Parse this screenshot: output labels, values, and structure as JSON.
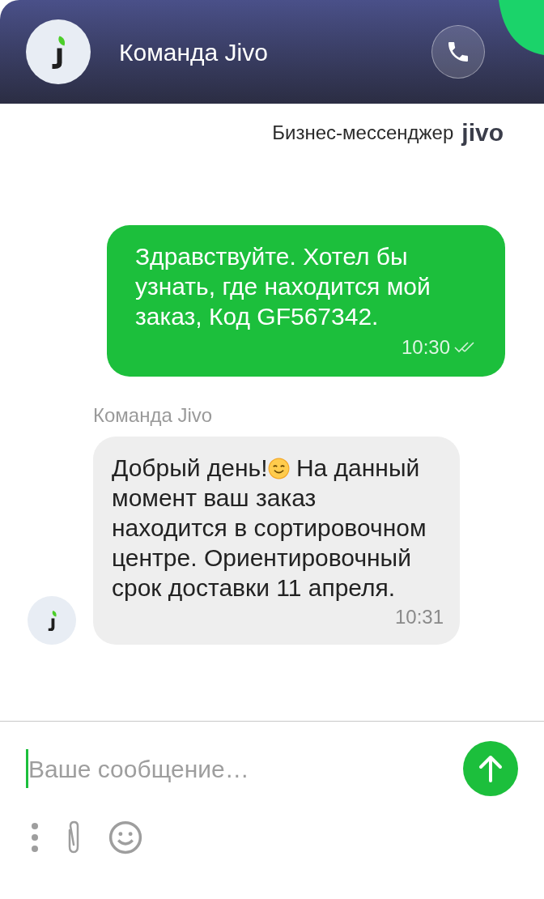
{
  "header": {
    "title": "Команда Jivo"
  },
  "branding": {
    "label": "Бизнес-мессенджер",
    "logo": "jivo"
  },
  "messages": [
    {
      "kind": "outgoing",
      "text": "Здравствуйте. Хотел бы узнать, где находится мой заказ, Код GF567342.",
      "time": "10:30",
      "read": true
    },
    {
      "kind": "incoming",
      "sender": "Команда Jivo",
      "text_before_emoji": "Добрый день!",
      "text_after_emoji": " На данный момент ваш заказ находится в сортировочном центре. Ориентировочный срок доставки 11 апреля.",
      "time": "10:31"
    }
  ],
  "composer": {
    "placeholder": "Ваше сообщение…"
  }
}
